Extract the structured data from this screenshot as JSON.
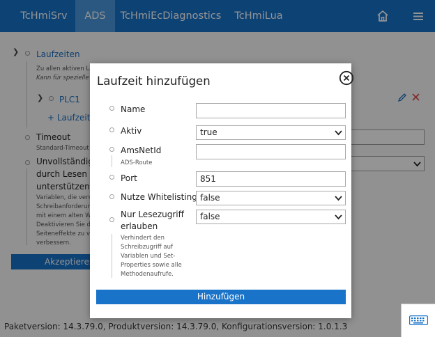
{
  "nav": {
    "tabs": [
      {
        "label": "TcHmiSrv",
        "active": false
      },
      {
        "label": "ADS",
        "active": true
      },
      {
        "label": "TcHmiEcDiagnostics",
        "active": false
      },
      {
        "label": "TcHmiLua",
        "active": false
      }
    ],
    "home_icon": "home-icon",
    "menu_icon": "hamburger-menu-icon"
  },
  "background": {
    "runtimes": {
      "label": "Laufzeiten",
      "desc_line1": "Zu allen aktiven La",
      "desc_line2": "Kann für spezielle"
    },
    "plc": {
      "label": "PLC1",
      "edit_icon": "pencil-icon",
      "delete_icon": "close-x-icon"
    },
    "add_runtime": "+ Laufzeit",
    "timeout": {
      "label": "Timeout",
      "desc": "Standard-Timeout"
    },
    "incomplete": {
      "line1": "Unvollständige",
      "line2": "durch Lesen v",
      "line3": "unterstützen",
      "desc": [
        "Variablen, die vers",
        "Schreibanforderun",
        "mit einem alten W",
        "Deaktivieren Sie di",
        "Seiteneffekte zu ve",
        "verbessern."
      ]
    },
    "accept_button": "Akzeptieren",
    "footer": "Paketversion: 14.3.79.0, Produktversion: 14.3.79.0, Konfigurationsversion: 1.0.1.3",
    "keyboard_icon": "keyboard-icon"
  },
  "modal": {
    "title": "Laufzeit hinzufügen",
    "close_icon": "close-circle-icon",
    "fields": {
      "name": {
        "label": "Name",
        "value": ""
      },
      "active": {
        "label": "Aktiv",
        "value": "true"
      },
      "amsnetid": {
        "label": "AmsNetId",
        "hint": "ADS-Route",
        "value": ""
      },
      "port": {
        "label": "Port",
        "value": "851"
      },
      "whitelist": {
        "label": "Nutze Whitelisting",
        "value": "false"
      },
      "readonly": {
        "label_line1": "Nur Lesezugriff",
        "label_line2": "erlauben",
        "value": "false",
        "hint": [
          "Verhindert den",
          "Schreibzugriff auf",
          "Variablen und Set-",
          "Properties sowie alle",
          "Methodenaufrufe."
        ]
      }
    },
    "submit_button": "Hinzufügen"
  },
  "colors": {
    "primary": "#1873c9",
    "active_tab": "#4a98dc",
    "link": "#1b6fc2",
    "delete": "#d9534f",
    "overlay": "rgba(0,0,0,0.42)"
  }
}
